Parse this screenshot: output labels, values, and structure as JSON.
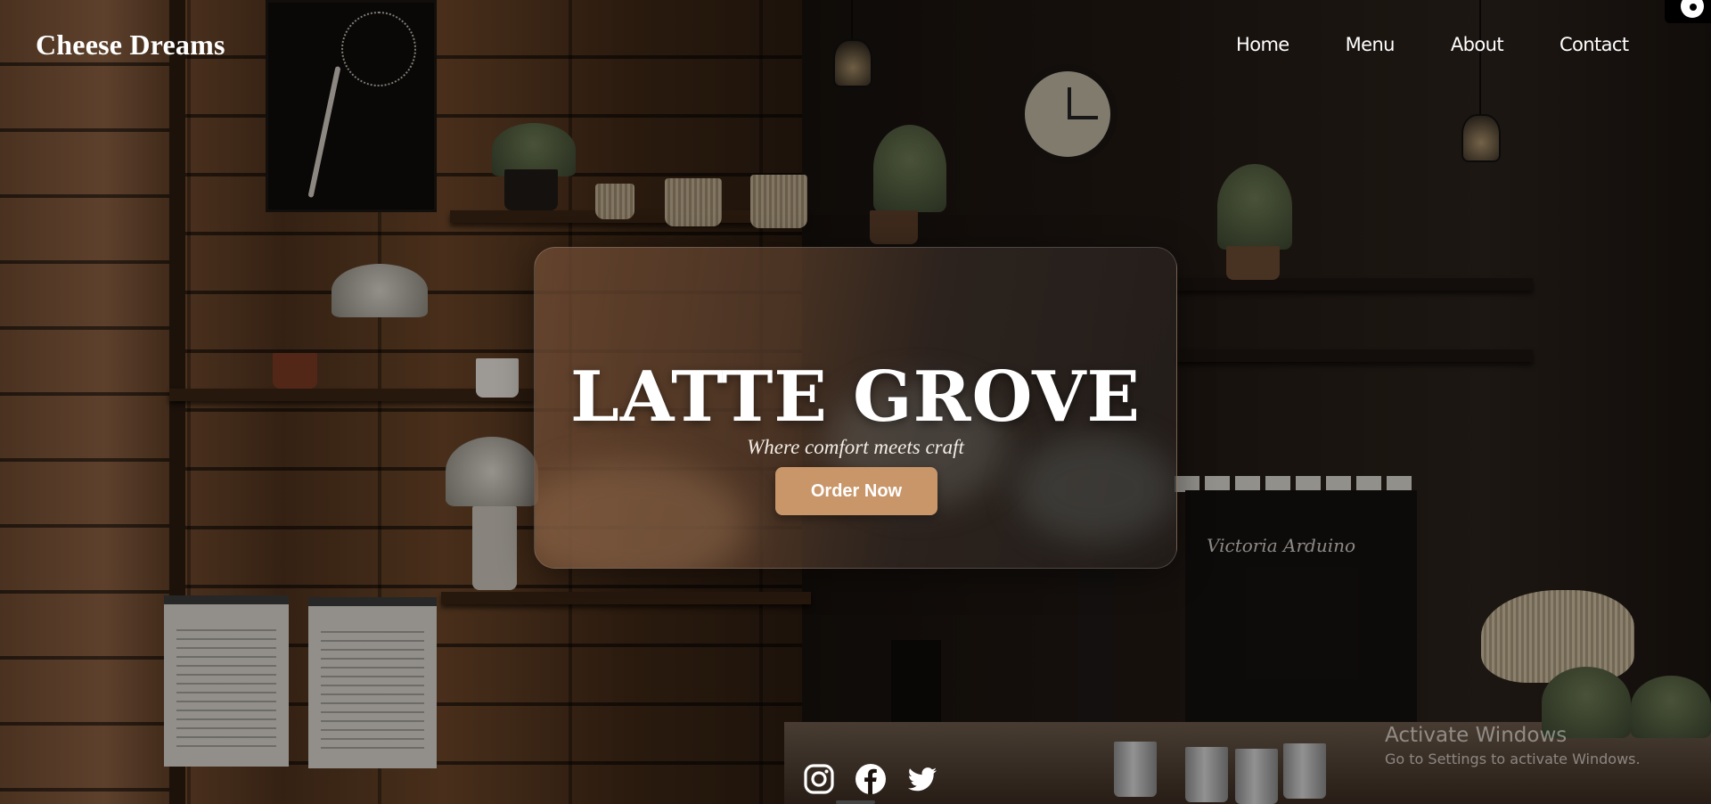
{
  "brand": {
    "name": "Cheese Dreams"
  },
  "nav": {
    "items": [
      {
        "label": "Home"
      },
      {
        "label": "Menu"
      },
      {
        "label": "About"
      },
      {
        "label": "Contact"
      }
    ]
  },
  "hero": {
    "title": "LATTE GROVE",
    "subtitle": "Where comfort meets craft",
    "cta_label": "Order Now"
  },
  "background": {
    "machine_brand": "Victoria Arduino"
  },
  "social": [
    {
      "icon": "instagram-icon"
    },
    {
      "icon": "facebook-icon"
    },
    {
      "icon": "twitter-icon"
    }
  ],
  "os_watermark": {
    "title": "Activate Windows",
    "subtitle": "Go to Settings to activate Windows."
  },
  "colors": {
    "accent": "#c9966a",
    "text": "#ffffff"
  }
}
